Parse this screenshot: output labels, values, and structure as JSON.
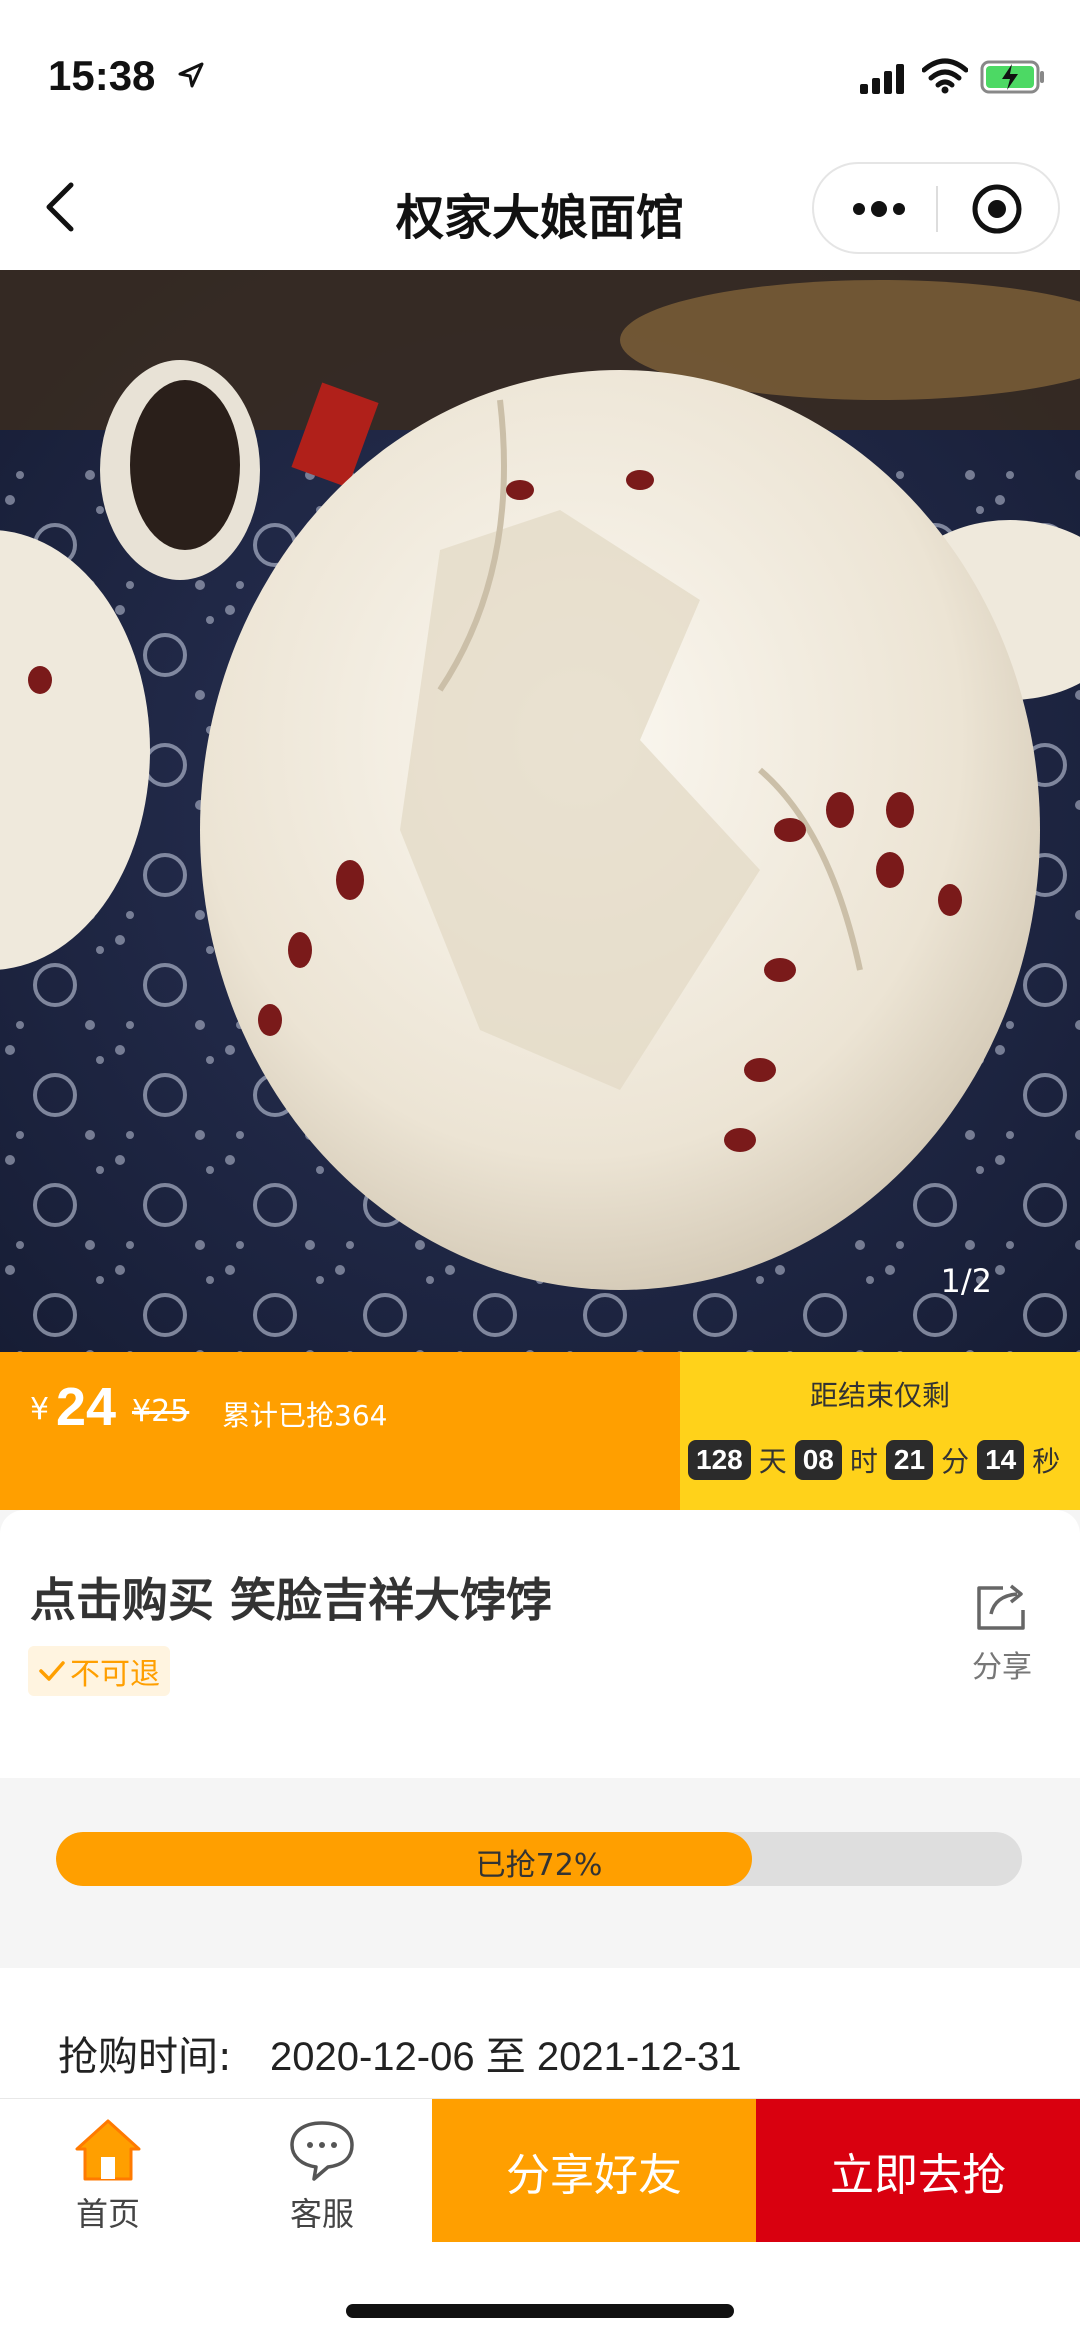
{
  "status": {
    "time": "15:38"
  },
  "nav": {
    "title": "权家大娘面馆"
  },
  "hero": {
    "counter": "1/2"
  },
  "price": {
    "currency": "¥",
    "current": "24",
    "original": "¥25",
    "sold": "累计已抢364"
  },
  "countdown": {
    "label": "距结束仅剩",
    "days": "128",
    "days_unit": "天",
    "hours": "08",
    "hours_unit": "时",
    "minutes": "21",
    "minutes_unit": "分",
    "seconds": "14",
    "seconds_unit": "秒"
  },
  "product": {
    "title": "点击购买 笑脸吉祥大饽饽",
    "tag": "不可退",
    "share_label": "分享"
  },
  "progress": {
    "text": "已抢72%",
    "fraction": 0.72
  },
  "purchase_time": {
    "label": "抢购时间:",
    "value": "2020-12-06 至 2021-12-31"
  },
  "bottom": {
    "home_label": "首页",
    "service_label": "客服",
    "share_button": "分享好友",
    "buy_button": "立即去抢"
  },
  "colors": {
    "accent": "#ff9f00",
    "countdown_bg": "#ffd21a",
    "buy": "#d9000f"
  }
}
